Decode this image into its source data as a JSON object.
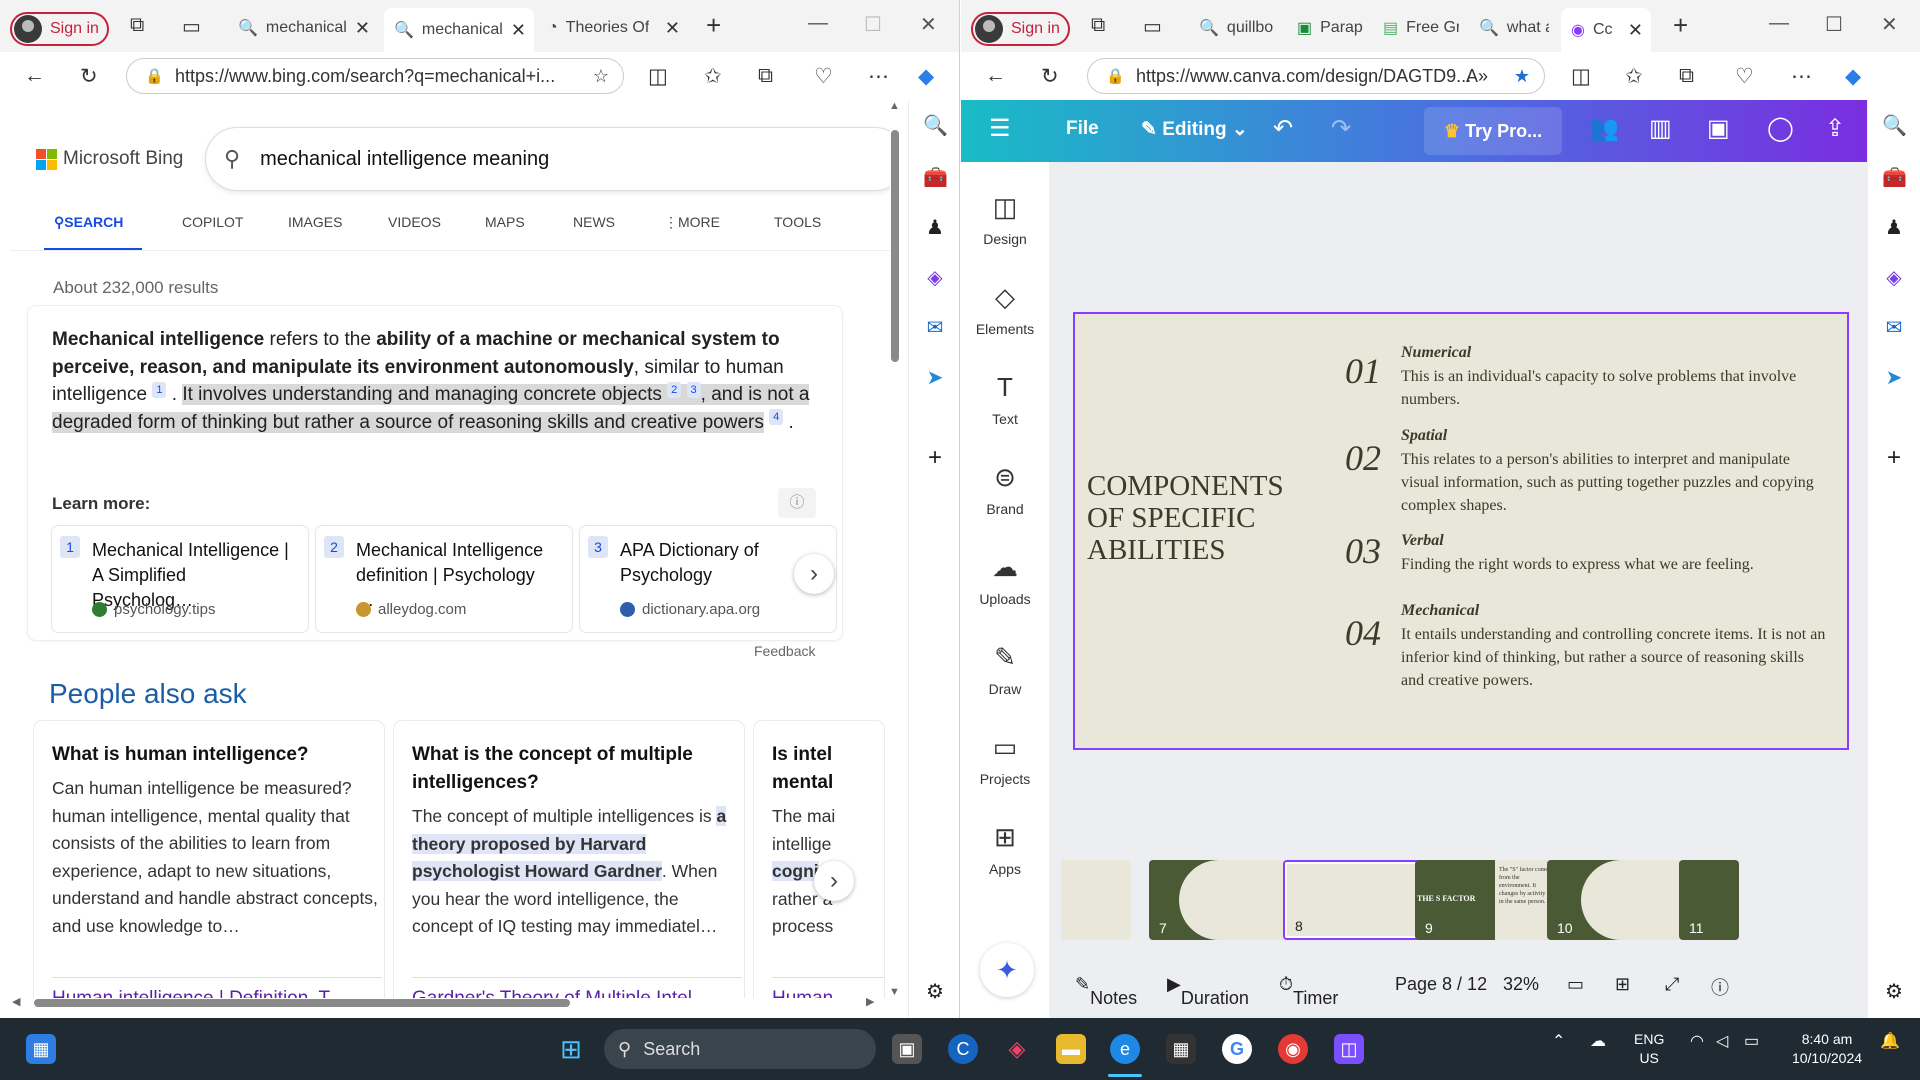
{
  "left": {
    "signin": "Sign in",
    "tabs": [
      {
        "label": "mechanical"
      },
      {
        "label": "mechanical"
      },
      {
        "label": "Theories Of"
      }
    ],
    "url": "https://www.bing.com/search?q=mechanical+i...",
    "bing": {
      "logo_text": "Microsoft Bing",
      "query": "mechanical intelligence meaning",
      "nav": [
        "SEARCH",
        "COPILOT",
        "IMAGES",
        "VIDEOS",
        "MAPS",
        "NEWS",
        "MORE",
        "TOOLS"
      ],
      "results_count": "About 232,000 results",
      "answer": {
        "p1": "Mechanical intelligence",
        "p2": " refers to the ",
        "p3": "ability of a machine or mechanical system to perceive, reason, and manipulate its environment autonomously",
        "p4": ", similar to human intelligence",
        "p5": "It involves understanding and managing concrete objects",
        "p6": ", and is not a degraded form of thinking but rather a source of reasoning skills and creative powers",
        "refs": [
          "1",
          "2",
          "3",
          "4"
        ],
        "end": "."
      },
      "learn_more": "Learn more:",
      "sources": [
        {
          "n": "1",
          "title": "Mechanical Intelligence | A Simplified Psycholog…",
          "domain": "psychology.tips"
        },
        {
          "n": "2",
          "title": "Mechanical Intelligence definition | Psychology …",
          "domain": "alleydog.com"
        },
        {
          "n": "3",
          "title": "APA Dictionary of Psychology",
          "domain": "dictionary.apa.org"
        }
      ],
      "feedback": "Feedback",
      "paa_title": "People also ask",
      "paa": [
        {
          "q": "What is human intelligence?",
          "a": "Can human intelligence be measured? human intelligence, mental quality that consists of the abilities to learn from experience, adapt to new situations, understand and handle abstract concepts, and use knowledge to…",
          "link": "Human intelligence | Definition, T…"
        },
        {
          "q": "What is the concept of multiple intelligences?",
          "a1": "The concept of multiple intelligences is ",
          "ah": "a theory proposed by Harvard psychologist Howard Gardner",
          "a2": ". When you hear the word intelligence, the concept of IQ testing may immediatel…",
          "link": "Gardner's Theory of Multiple Intel…"
        },
        {
          "q": "Is intel mental",
          "a1": "The mai intellige ",
          "ah": "cogni",
          "a2": " rather a process",
          "link": "Human"
        }
      ]
    }
  },
  "right": {
    "signin": "Sign in",
    "tabs": [
      {
        "label": "quillbo"
      },
      {
        "label": "Paraphr"
      },
      {
        "label": "Free Gr"
      },
      {
        "label": "what ar"
      },
      {
        "label": "Cc"
      }
    ],
    "url": "https://www.canva.com/design/DAGTD9...",
    "canva": {
      "file": "File",
      "editing": "Editing",
      "trypro": "Try Pro...",
      "side": [
        "Design",
        "Elements",
        "Text",
        "Brand",
        "Uploads",
        "Draw",
        "Projects",
        "Apps"
      ],
      "slide": {
        "title": "COMPONENTS OF SPECIFIC ABILITIES",
        "items": [
          {
            "num": "01",
            "head": "Numerical",
            "text": "This is an individual's capacity to solve problems that involve numbers."
          },
          {
            "num": "02",
            "head": "Spatial",
            "text": "This relates to a person's abilities to interpret and manipulate visual information, such as putting together puzzles and copying complex shapes."
          },
          {
            "num": "03",
            "head": "Verbal",
            "text": "Finding the right words to express what we are feeling."
          },
          {
            "num": "04",
            "head": "Mechanical",
            "text": "It entails understanding and controlling concrete items. It is not an inferior kind of thinking, but rather a source of reasoning skills and creative powers."
          }
        ]
      },
      "thumbs": [
        "7",
        "8",
        "9",
        "10",
        "11"
      ],
      "thumb9_title": "THE S FACTOR",
      "thumb9_text": "The \"S\" factor comes from the environment. It changes by activity in the same person.",
      "footer": {
        "notes": "Notes",
        "duration": "Duration",
        "timer": "Timer",
        "page": "Page 8 / 12",
        "zoom": "32%"
      }
    }
  },
  "taskbar": {
    "search": "Search",
    "lang1": "ENG",
    "lang2": "US",
    "time": "8:40 am",
    "date": "10/10/2024"
  }
}
